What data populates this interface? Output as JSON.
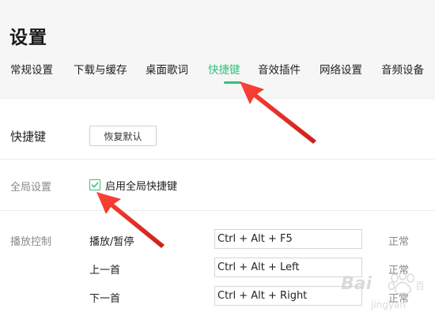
{
  "header": {
    "title": "设置"
  },
  "tabs": [
    {
      "label": "常规设置"
    },
    {
      "label": "下载与缓存"
    },
    {
      "label": "桌面歌词"
    },
    {
      "label": "快捷键"
    },
    {
      "label": "音效插件"
    },
    {
      "label": "网络设置"
    },
    {
      "label": "音频设备"
    }
  ],
  "active_tab": "快捷键",
  "shortcuts_section": {
    "title": "快捷键",
    "reset_button": "恢复默认"
  },
  "global_settings": {
    "label": "全局设置",
    "checkbox_label": "启用全局快捷键",
    "checked": true
  },
  "playback_control": {
    "label": "播放控制",
    "rows": [
      {
        "action": "播放/暂停",
        "shortcut": "Ctrl + Alt + F5",
        "status": "正常"
      },
      {
        "action": "上一首",
        "shortcut": "Ctrl + Alt + Left",
        "status": "正常"
      },
      {
        "action": "下一首",
        "shortcut": "Ctrl + Alt + Right",
        "status": "正常"
      }
    ]
  },
  "colors": {
    "accent": "#31c27c",
    "annotation_arrow": "#e8231f"
  }
}
